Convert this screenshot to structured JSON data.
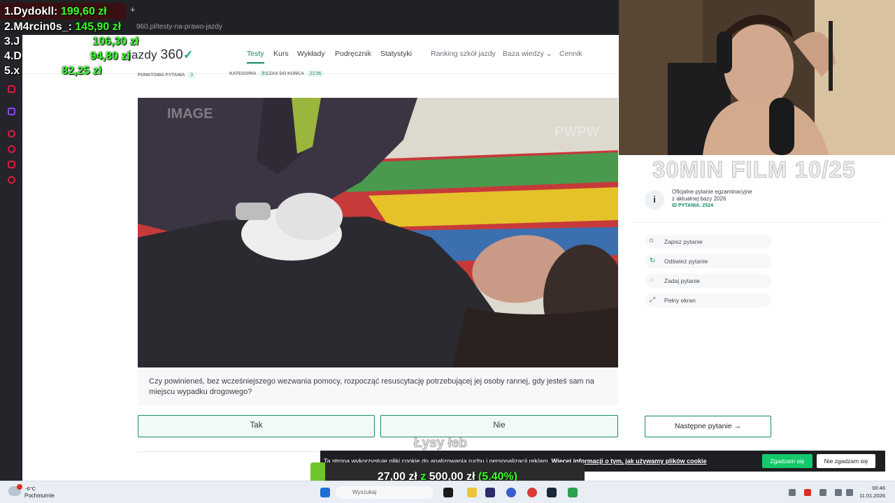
{
  "browser": {
    "url": "960.pl/testy-na-prawo-jazdy",
    "new_tab_symbol": "+"
  },
  "site": {
    "logo_text": "jazdy",
    "logo_number": "360",
    "nav": [
      {
        "label": "Testy"
      },
      {
        "label": "Kurs"
      },
      {
        "label": "Wykłady"
      },
      {
        "label": "Podręcznik"
      },
      {
        "label": "Statystyki"
      },
      {
        "label": "Ranking szkół jazdy"
      },
      {
        "label": "Baza wiedzy"
      },
      {
        "label": "Cennik"
      }
    ],
    "nav_dropdown_symbol": "⌄"
  },
  "question_meta": {
    "points_label": "PUNKTOWA PYTANIA",
    "points_value": "3",
    "category_label": "KATEGORIA",
    "category_value": "B",
    "time_label": "CZAS DO KOŃCA",
    "time_value": "22:36"
  },
  "image_watermarks": {
    "left": "IMAGE",
    "right": "PWPW"
  },
  "question": {
    "text": "Czy powinieneś, bez wcześniejszego wezwania pomocy, rozpocząć resuscytację potrzebującej jej osoby rannej, gdy jesteś sam na miejscu wypadku drogowego?"
  },
  "answers": {
    "yes": "Tak",
    "no": "Nie"
  },
  "side_panel": {
    "banner": "30MIN FILM 10/25",
    "info_icon": "i",
    "info_line1": "Oficjalne pytanie egzaminacyjne",
    "info_line2": "z aktualnej bazy 2026",
    "info_id": "ID PYTANIA: 2524",
    "actions": [
      {
        "label": "Zapisz pytanie",
        "icon": "bookmark-icon",
        "glyph": "⌑"
      },
      {
        "label": "Odśwież pytanie",
        "icon": "refresh-icon",
        "glyph": "↻"
      },
      {
        "label": "Zadaj pytanie",
        "icon": "chat-icon",
        "glyph": "◌"
      },
      {
        "label": "Pełny ekran",
        "icon": "fullscreen-icon",
        "glyph": "⤢"
      }
    ],
    "next_button": "Następne pytanie →"
  },
  "leaderboard": [
    {
      "rank": "1.Dydokll:",
      "amount": "199,60 zł"
    },
    {
      "rank": "2.M4rcin0s_:",
      "amount": "145,90 zł"
    },
    {
      "rank": "3.J",
      "amount": "106,30 zł"
    },
    {
      "rank": "4.D",
      "amount": "94,80 zł"
    },
    {
      "rank": "5.x",
      "amount": "82,25 zł"
    }
  ],
  "donation": {
    "donor": "Łysy łeb",
    "goal_current": "27,00 zł",
    "goal_z": "z",
    "goal_target": "500,00 zł",
    "goal_percent_label": "(5.40%)",
    "goal_fraction": 0.054
  },
  "cookie": {
    "text": "Ta strona wykorzystuje pliki cookie do analizowania ruchu i personalizacji reklam.",
    "link": "Więcej informacji o tym, jak używamy plików cookie",
    "accept": "Zgadzam się",
    "reject": "Nie zgadzam się"
  },
  "taskbar": {
    "temperature": "-6°C",
    "weather": "Pochmurnie",
    "search_placeholder": "Wyszukaj",
    "time": "00:46",
    "date": "11.01.2026"
  },
  "colors": {
    "accent": "#15896a",
    "leaderboard_amount": "#39ff2a",
    "cookie_accept": "#13c96b"
  }
}
